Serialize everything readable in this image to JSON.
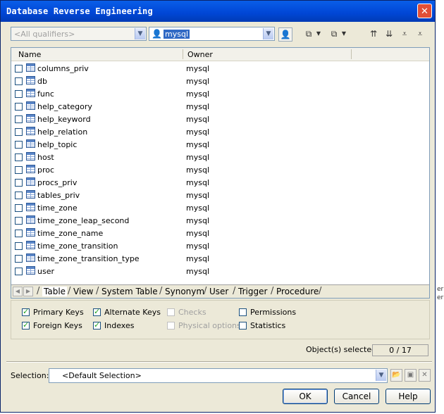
{
  "window": {
    "title": "Database Reverse Engineering",
    "close_label": "✕"
  },
  "toolbar": {
    "qualifier_placeholder": "<All qualifiers>",
    "owner_value": "mysql"
  },
  "list": {
    "columns": [
      "Name",
      "Owner"
    ],
    "rows": [
      {
        "name": "columns_priv",
        "owner": "mysql"
      },
      {
        "name": "db",
        "owner": "mysql"
      },
      {
        "name": "func",
        "owner": "mysql"
      },
      {
        "name": "help_category",
        "owner": "mysql"
      },
      {
        "name": "help_keyword",
        "owner": "mysql"
      },
      {
        "name": "help_relation",
        "owner": "mysql"
      },
      {
        "name": "help_topic",
        "owner": "mysql"
      },
      {
        "name": "host",
        "owner": "mysql"
      },
      {
        "name": "proc",
        "owner": "mysql"
      },
      {
        "name": "procs_priv",
        "owner": "mysql"
      },
      {
        "name": "tables_priv",
        "owner": "mysql"
      },
      {
        "name": "time_zone",
        "owner": "mysql"
      },
      {
        "name": "time_zone_leap_second",
        "owner": "mysql"
      },
      {
        "name": "time_zone_name",
        "owner": "mysql"
      },
      {
        "name": "time_zone_transition",
        "owner": "mysql"
      },
      {
        "name": "time_zone_transition_type",
        "owner": "mysql"
      },
      {
        "name": "user",
        "owner": "mysql"
      }
    ]
  },
  "tabs": [
    "Table",
    "View",
    "System Table",
    "Synonym",
    "User",
    "Trigger",
    "Procedure"
  ],
  "options": [
    {
      "label": "Primary Keys",
      "checked": true,
      "enabled": true
    },
    {
      "label": "Alternate Keys",
      "checked": true,
      "enabled": true
    },
    {
      "label": "Checks",
      "checked": false,
      "enabled": false
    },
    {
      "label": "Permissions",
      "checked": false,
      "enabled": true
    },
    {
      "label": "Foreign Keys",
      "checked": true,
      "enabled": true
    },
    {
      "label": "Indexes",
      "checked": true,
      "enabled": true
    },
    {
      "label": "Physical options",
      "checked": false,
      "enabled": false
    },
    {
      "label": "Statistics",
      "checked": false,
      "enabled": true
    }
  ],
  "status": {
    "selected_label": "Object(s) selected:",
    "selected_value": "0 / 17"
  },
  "selection": {
    "label": "Selection:",
    "value": "<Default Selection>"
  },
  "buttons": {
    "ok": "OK",
    "cancel": "Cancel",
    "help": "Help"
  },
  "background_fragments": [
    "er",
    "er"
  ]
}
